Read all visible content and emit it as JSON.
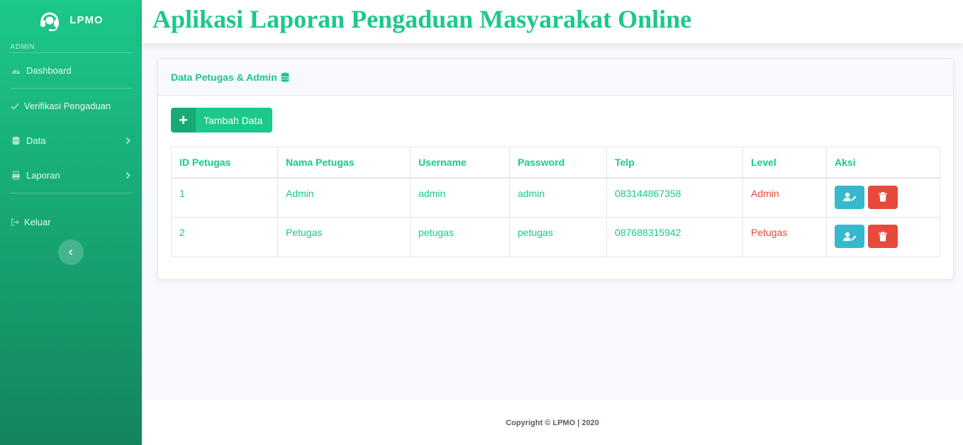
{
  "brand": {
    "name": "LPMO"
  },
  "sidebar": {
    "heading": "ADMIN",
    "items": [
      {
        "label": "Dashboard",
        "icon": "dashboard-icon"
      },
      {
        "label": "Verifikasi Pengaduan",
        "icon": "check-icon"
      },
      {
        "label": "Data",
        "icon": "database-icon"
      },
      {
        "label": "Laporan",
        "icon": "print-icon"
      },
      {
        "label": "Keluar",
        "icon": "sign-out-icon"
      }
    ]
  },
  "header": {
    "title": "Aplikasi Laporan Pengaduan Masyarakat Online"
  },
  "card": {
    "title": "Data Petugas & Admin",
    "add_label": "Tambah Data"
  },
  "table": {
    "columns": [
      "ID Petugas",
      "Nama Petugas",
      "Username",
      "Password",
      "Telp",
      "Level",
      "Aksi"
    ],
    "rows": [
      {
        "id": "1",
        "nama": "Admin",
        "username": "admin",
        "password": "admin",
        "telp": "083144867358",
        "level": "Admin"
      },
      {
        "id": "2",
        "nama": "Petugas",
        "username": "petugas",
        "password": "petugas",
        "telp": "087688315942",
        "level": "Petugas"
      }
    ]
  },
  "footer": {
    "copyright": "Copyright © LPMO | 2020"
  },
  "colors": {
    "primary": "#1cc88a",
    "info": "#36b9cc",
    "danger": "#e74a3b"
  }
}
